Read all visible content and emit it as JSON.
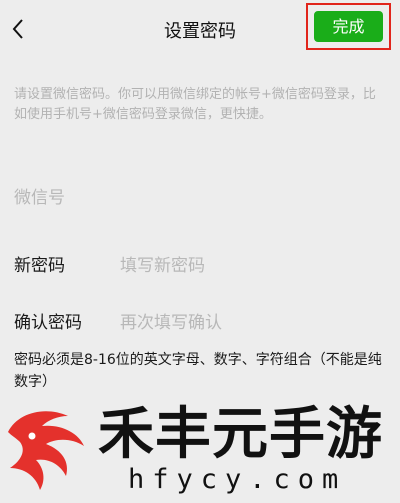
{
  "header": {
    "title": "设置密码",
    "done_label": "完成"
  },
  "hint": "请设置微信密码。你可以用微信绑定的帐号+微信密码登录，比如使用手机号+微信密码登录微信，更快捷。",
  "fields": {
    "wechat_id": {
      "label": "微信号"
    },
    "new_password": {
      "label": "新密码",
      "placeholder": "填写新密码"
    },
    "confirm_password": {
      "label": "确认密码",
      "placeholder": "再次填写确认"
    }
  },
  "rule": "密码必须是8-16位的英文字母、数字、字符组合（不能是纯数字）",
  "watermark": {
    "name": "禾丰元手游",
    "domain": "hfycy.com"
  },
  "colors": {
    "background": "#ededed",
    "accent_green": "#1aad19",
    "highlight_red": "#e1251b",
    "placeholder_gray": "#b8b8b8",
    "logo_red": "#e4312c"
  },
  "icons": [
    "back-arrow-icon",
    "logo-icon"
  ]
}
